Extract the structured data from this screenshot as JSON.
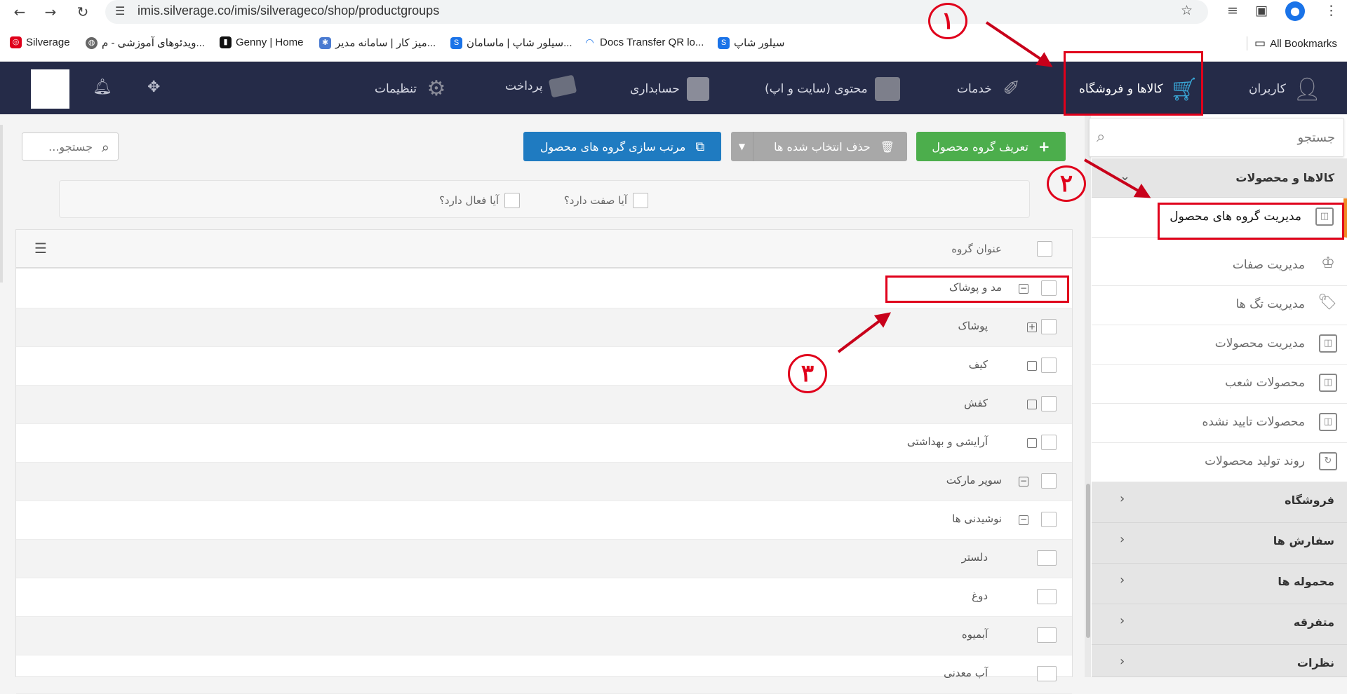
{
  "browser": {
    "url": "imis.silverage.co/imis/silverageco/shop/productgroups",
    "bookmarks": [
      {
        "label": "Silverage",
        "icon": "silverage-logo-icon",
        "color": "#e0001b"
      },
      {
        "label": "ویدئوهای آموزشی - م...",
        "icon": "globe-icon",
        "color": "#555555"
      },
      {
        "label": "Genny | Home",
        "icon": "genny-logo-icon",
        "color": "#111111"
      },
      {
        "label": "میز کار | سامانه مدیر...",
        "icon": "app-icon",
        "color": "#4a7bd1"
      },
      {
        "label": "سیلور شاپ | ماسامان...",
        "icon": "shop-icon",
        "color": "#1a73e8"
      },
      {
        "label": "Docs Transfer QR lo...",
        "icon": "wifi-icon",
        "color": "#1a73e8"
      },
      {
        "label": "سیلور شاپ",
        "icon": "shop-icon",
        "color": "#1a73e8"
      }
    ],
    "all_bookmarks": "All Bookmarks"
  },
  "topnav": {
    "items": [
      {
        "label": "کاربران",
        "icon": "users-icon"
      },
      {
        "label": "کالاها و فروشگاه",
        "icon": "cart-icon"
      },
      {
        "label": "خدمات",
        "icon": "brush-icon"
      },
      {
        "label": "محتوی (سایت و اپ)",
        "icon": "folder-icon"
      },
      {
        "label": "حسابداری",
        "icon": "calculator-icon"
      },
      {
        "label": "پرداخت",
        "icon": "card-icon"
      },
      {
        "label": "تنظیمات",
        "icon": "gears-icon"
      }
    ]
  },
  "annotations": [
    "١",
    "٢",
    "٣"
  ],
  "sidebar": {
    "search_placeholder": "جستجو",
    "section_products": "کالاها و محصولات",
    "items": [
      {
        "label": "مدیریت گروه های محصول",
        "active": true
      },
      {
        "label": "مدیریت صفات",
        "active": false
      },
      {
        "label": "مدیریت تگ ها",
        "active": false
      },
      {
        "label": "مدیریت محصولات",
        "active": false
      },
      {
        "label": "محصولات شعب",
        "active": false
      },
      {
        "label": "محصولات تایید نشده",
        "active": false
      },
      {
        "label": "روند تولید محصولات",
        "active": false
      }
    ],
    "sections": [
      "فروشگاه",
      "سفارش ها",
      "محموله ها",
      "متفرقه",
      "نظرات"
    ]
  },
  "toolbar": {
    "add_group": "تعریف گروه محصول",
    "delete_selected": "حذف انتخاب شده ها",
    "sort_groups": "مرتب سازی گروه های محصول",
    "search_placeholder": "جستجو..."
  },
  "filters": {
    "has_attribute": "آیا صفت دارد؟",
    "is_active": "آیا فعال دارد؟"
  },
  "grid": {
    "header": "عنوان گروه",
    "rows": [
      {
        "label": "مد و پوشاک",
        "level": 0,
        "expander": "minus"
      },
      {
        "label": "پوشاک",
        "level": 1,
        "expander": "plus"
      },
      {
        "label": "کیف",
        "level": 1,
        "expander": "none"
      },
      {
        "label": "کفش",
        "level": 1,
        "expander": "none"
      },
      {
        "label": "آرایشی و بهداشتی",
        "level": 1,
        "expander": "none"
      },
      {
        "label": "سوپر مارکت",
        "level": 0,
        "expander": "minus"
      },
      {
        "label": "نوشیدنی ها",
        "level": 0,
        "expander": "minus"
      },
      {
        "label": "دلستر",
        "level": 2,
        "expander": "leaf"
      },
      {
        "label": "دوغ",
        "level": 2,
        "expander": "leaf"
      },
      {
        "label": "آبمیوه",
        "level": 2,
        "expander": "leaf"
      },
      {
        "label": "آب معدنی",
        "level": 2,
        "expander": "leaf"
      }
    ]
  },
  "colors": {
    "nav_bg": "#252b48",
    "green": "#4cae4c",
    "gray_btn": "#9b9b9b",
    "blue": "#1f7bc1",
    "annotation_red": "#e0001b",
    "active_accent": "#f08a24"
  }
}
